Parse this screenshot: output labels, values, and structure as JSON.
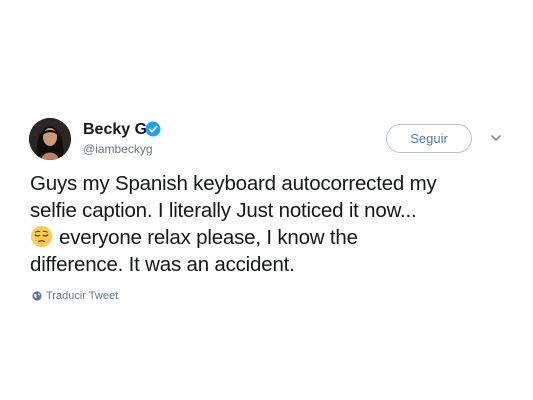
{
  "author": {
    "display_name": "Becky G.",
    "handle": "@iambeckyg",
    "verified": true
  },
  "follow_button": {
    "label": "Seguir"
  },
  "menu": {
    "icon": "chevron-down-icon"
  },
  "tweet": {
    "lines": [
      "Guys my Spanish keyboard autocorrected my",
      "selfie caption. I literally Just noticed it now...",
      "everyone relax please, I know the",
      "difference. It was an accident."
    ],
    "emoji": "pensive-face-icon"
  },
  "translate": {
    "label": "Traducir Tweet",
    "icon": "globe-icon"
  },
  "colors": {
    "text": "#14171a",
    "secondary": "#657786",
    "accent": "#1da1f2",
    "button_text": "#4a7da8",
    "button_border": "#b9c4ce"
  }
}
